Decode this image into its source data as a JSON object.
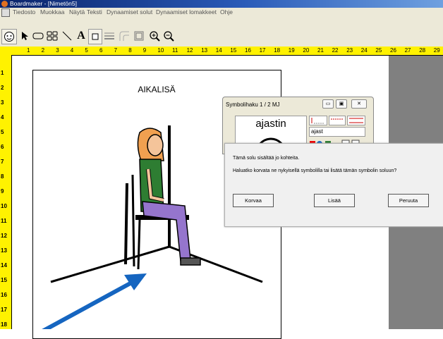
{
  "window": {
    "title": "Boardmaker - [Nimetön5]"
  },
  "menu": [
    "Tiedosto",
    "Muokkaa",
    "Näytä",
    "Teksti",
    "Dynaamiset solut",
    "Dynaamiset lomakkeet",
    "Ohje"
  ],
  "toolbar": {
    "tools": [
      "face-icon",
      "pointer-icon",
      "button-tool-icon",
      "grid-tool-icon",
      "line-tool-icon",
      "text-tool-icon",
      "color-fill-icon",
      "line-thickness-icon",
      "corner-icon",
      "border-icon",
      "zoom-in-icon",
      "zoom-out-icon"
    ],
    "text_tool": "A"
  },
  "ruler": {
    "top": [
      "1",
      "2",
      "3",
      "4",
      "5",
      "6",
      "7",
      "8",
      "9",
      "10",
      "11",
      "12",
      "13",
      "14",
      "15",
      "16",
      "17",
      "18",
      "19",
      "20",
      "21",
      "22",
      "23",
      "24",
      "25",
      "26",
      "27",
      "28",
      "29"
    ],
    "left": [
      "1",
      "2",
      "3",
      "4",
      "5",
      "6",
      "7",
      "8",
      "9",
      "10",
      "11",
      "12",
      "13",
      "14",
      "15",
      "16",
      "17",
      "18"
    ]
  },
  "page": {
    "heading": "AIKALISÄ"
  },
  "symbol_search": {
    "title": "Symbolihaku",
    "page": "1 / 2",
    "mj": "MJ",
    "word": "ajastin",
    "query": "ajast"
  },
  "dialog": {
    "message1": "Tämä solu sisältää jo kohteita.",
    "message2": "Haluatko korvata ne nykyisellä symbolilla tai lisätä tämän symbolin soluun?",
    "replace_label": "Korvaa",
    "add_label": "Lisää",
    "cancel_label": "Peruuta"
  },
  "colors": {
    "ruler": "#fff200",
    "canvas_grey": "#808080",
    "arrow": "#1565c0",
    "shirt": "#2e7d32",
    "pants": "#9575cd",
    "hair": "#f0a050"
  }
}
